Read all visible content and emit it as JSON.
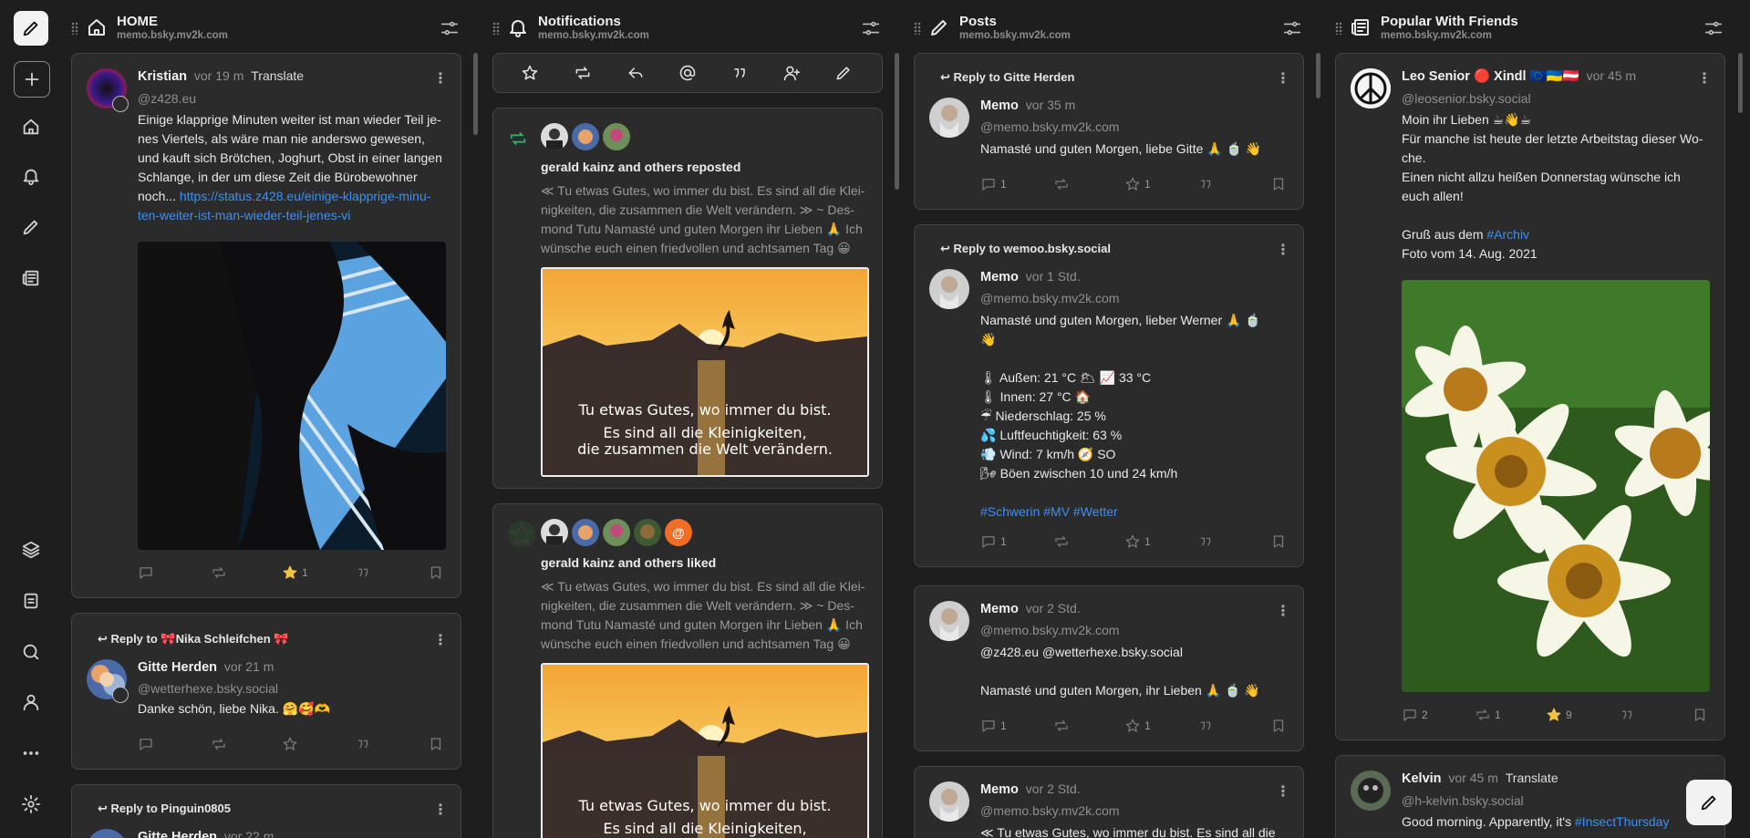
{
  "columns": {
    "home": {
      "title": "HOME",
      "subtitle": "memo.bsky.mv2k.com"
    },
    "notifications": {
      "title": "Notifications",
      "subtitle": "memo.bsky.mv2k.com"
    },
    "posts": {
      "title": "Posts",
      "subtitle": "memo.bsky.mv2k.com"
    },
    "popular": {
      "title": "Popular With Friends",
      "subtitle": "memo.bsky.mv2k.com"
    }
  },
  "home_posts": [
    {
      "name": "Kristian",
      "time": "vor 19 m",
      "translate": "Translate",
      "handle": "@z428.eu",
      "text": "Einige klapprige Minuten weiter ist man wieder Teil je-nes Viertels, als wäre man nie anderswo gewesen, und kauft sich Brötchen, Joghurt, Obst in einer langen Schlange, in der um diese Zeit die Bürobewohner noch...",
      "link": "https://status.z428.eu/einige-klapprige-minu-ten-weiter-ist-man-wieder-teil-jenes-vi",
      "likes": "1"
    },
    {
      "reply_to": "Reply to 🎀Nika Schleifchen 🎀",
      "name": "Gitte Herden",
      "time": "vor 21 m",
      "handle": "@wetterhexe.bsky.social",
      "text": "Danke schön, liebe Nika. 🤗🥰🫶"
    },
    {
      "reply_to": "Reply to Pinguin0805",
      "name": "Gitte Herden",
      "time": "vor 22 m"
    }
  ],
  "notifications_items": [
    {
      "title": "gerald kainz and others reposted",
      "text": "≪ Tu etwas Gutes, wo immer du bist. Es sind all die Klei-nigkeiten, die zusammen die Welt verändern. ≫ ~ Des-mond Tutu Namasté und guten Morgen ihr Lieben 🙏 Ich wünsche euch einen friedvollen und achtsamen Tag 😀",
      "image_line1": "Tu etwas Gutes, wo immer du bist.",
      "image_line2": "Es sind all die Kleinigkeiten,",
      "image_line3": "die zusammen die Welt verändern."
    },
    {
      "title": "gerald kainz and others liked",
      "text": "≪ Tu etwas Gutes, wo immer du bist. Es sind all die Klei-nigkeiten, die zusammen die Welt verändern. ≫ ~ Des-mond Tutu Namasté und guten Morgen ihr Lieben 🙏 Ich wünsche euch einen friedvollen und achtsamen Tag 😀",
      "image_line1": "Tu etwas Gutes, wo immer du bist.",
      "image_line2": "Es sind all die Kleinigkeiten,",
      "badge": "@"
    }
  ],
  "posts_items": [
    {
      "reply_to": "Reply to Gitte Herden",
      "name": "Memo",
      "time": "vor 35 m",
      "handle": "@memo.bsky.mv2k.com",
      "text": "Namasté und guten Morgen, liebe Gitte  🙏 🍵 👋",
      "replies": "1",
      "likes": "1"
    },
    {
      "reply_to": "Reply to wemoo.bsky.social",
      "name": "Memo",
      "time": "vor 1 Std.",
      "handle": "@memo.bsky.mv2k.com",
      "text_lines": [
        "Namasté und guten Morgen, lieber Werner  🙏 🍵",
        "👋",
        "",
        "🌡 Außen: 21 °C 🌥 📈 33 °C",
        "🌡 Innen: 27 °C 🏠",
        "☔ Niederschlag: 25 %",
        "💦 Luftfeuchtigkeit: 63 %",
        "💨 Wind: 7 km/h 🧭 SO",
        "🌬 Böen zwischen 10 und 24 km/h",
        ""
      ],
      "hashtags": "#Schwerin #MV #Wetter",
      "replies": "1",
      "likes": "1"
    },
    {
      "name": "Memo",
      "time": "vor 2 Std.",
      "handle": "@memo.bsky.mv2k.com",
      "mentions": "@z428.eu  @wetterhexe.bsky.social",
      "text": "Namasté und guten Morgen, ihr Lieben  🙏 🍵 👋",
      "replies": "1",
      "likes": "1"
    },
    {
      "name": "Memo",
      "time": "vor 2 Std.",
      "handle": "@memo.bsky.mv2k.com",
      "text": "≪ Tu etwas Gutes, wo immer du bist. Es sind all die"
    }
  ],
  "popular_items": [
    {
      "name": "Leo Senior 🔴 Xindl 🇪🇺🇺🇦🇦🇹",
      "time": "vor 45 m",
      "handle": "@leosenior.bsky.social",
      "text_lines": [
        "Moin ihr Lieben ☕👋☕",
        "Für manche ist heute der letzte Arbeitstag dieser Wo-",
        "che.",
        "Einen nicht allzu heißen Donnerstag wünsche ich",
        "euch allen!",
        ""
      ],
      "greeting_prefix": "Gruß aus dem ",
      "greeting_tag": "#Archiv",
      "photo_line": "Foto vom 14. Aug. 2021",
      "replies": "2",
      "reposts": "1",
      "likes": "9"
    },
    {
      "name": "Kelvin",
      "time": "vor 45 m",
      "translate": "Translate",
      "handle": "@h-kelvin.bsky.social",
      "text_prefix": "Good morning. Apparently, it's ",
      "text_tag": "#InsectThursday"
    }
  ],
  "colors": {
    "background": "#1e1e1e",
    "card": "#2b2b2b",
    "link": "#3d8ff5",
    "star": "#f5c242"
  }
}
